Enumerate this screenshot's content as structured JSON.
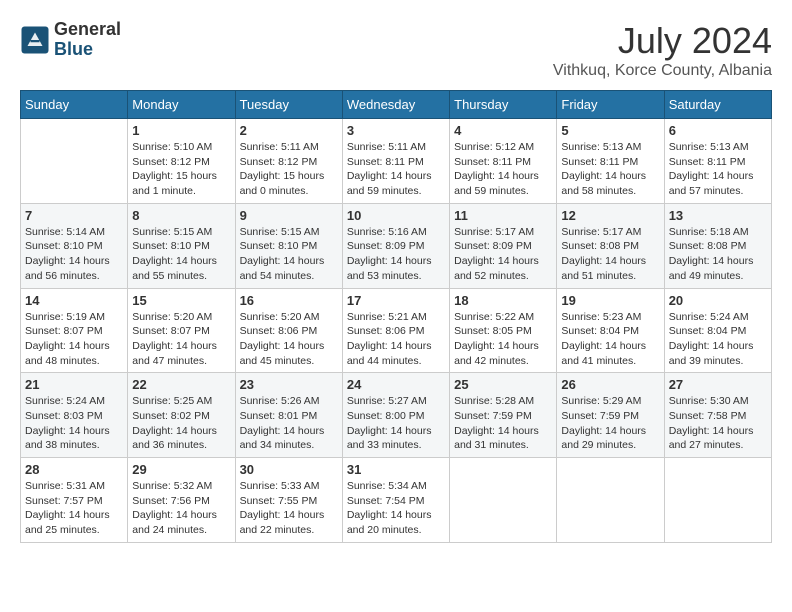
{
  "logo": {
    "general": "General",
    "blue": "Blue"
  },
  "title": {
    "month_year": "July 2024",
    "location": "Vithkuq, Korce County, Albania"
  },
  "calendar": {
    "headers": [
      "Sunday",
      "Monday",
      "Tuesday",
      "Wednesday",
      "Thursday",
      "Friday",
      "Saturday"
    ],
    "weeks": [
      [
        {
          "day": "",
          "info": ""
        },
        {
          "day": "1",
          "info": "Sunrise: 5:10 AM\nSunset: 8:12 PM\nDaylight: 15 hours\nand 1 minute."
        },
        {
          "day": "2",
          "info": "Sunrise: 5:11 AM\nSunset: 8:12 PM\nDaylight: 15 hours\nand 0 minutes."
        },
        {
          "day": "3",
          "info": "Sunrise: 5:11 AM\nSunset: 8:11 PM\nDaylight: 14 hours\nand 59 minutes."
        },
        {
          "day": "4",
          "info": "Sunrise: 5:12 AM\nSunset: 8:11 PM\nDaylight: 14 hours\nand 59 minutes."
        },
        {
          "day": "5",
          "info": "Sunrise: 5:13 AM\nSunset: 8:11 PM\nDaylight: 14 hours\nand 58 minutes."
        },
        {
          "day": "6",
          "info": "Sunrise: 5:13 AM\nSunset: 8:11 PM\nDaylight: 14 hours\nand 57 minutes."
        }
      ],
      [
        {
          "day": "7",
          "info": "Sunrise: 5:14 AM\nSunset: 8:10 PM\nDaylight: 14 hours\nand 56 minutes."
        },
        {
          "day": "8",
          "info": "Sunrise: 5:15 AM\nSunset: 8:10 PM\nDaylight: 14 hours\nand 55 minutes."
        },
        {
          "day": "9",
          "info": "Sunrise: 5:15 AM\nSunset: 8:10 PM\nDaylight: 14 hours\nand 54 minutes."
        },
        {
          "day": "10",
          "info": "Sunrise: 5:16 AM\nSunset: 8:09 PM\nDaylight: 14 hours\nand 53 minutes."
        },
        {
          "day": "11",
          "info": "Sunrise: 5:17 AM\nSunset: 8:09 PM\nDaylight: 14 hours\nand 52 minutes."
        },
        {
          "day": "12",
          "info": "Sunrise: 5:17 AM\nSunset: 8:08 PM\nDaylight: 14 hours\nand 51 minutes."
        },
        {
          "day": "13",
          "info": "Sunrise: 5:18 AM\nSunset: 8:08 PM\nDaylight: 14 hours\nand 49 minutes."
        }
      ],
      [
        {
          "day": "14",
          "info": "Sunrise: 5:19 AM\nSunset: 8:07 PM\nDaylight: 14 hours\nand 48 minutes."
        },
        {
          "day": "15",
          "info": "Sunrise: 5:20 AM\nSunset: 8:07 PM\nDaylight: 14 hours\nand 47 minutes."
        },
        {
          "day": "16",
          "info": "Sunrise: 5:20 AM\nSunset: 8:06 PM\nDaylight: 14 hours\nand 45 minutes."
        },
        {
          "day": "17",
          "info": "Sunrise: 5:21 AM\nSunset: 8:06 PM\nDaylight: 14 hours\nand 44 minutes."
        },
        {
          "day": "18",
          "info": "Sunrise: 5:22 AM\nSunset: 8:05 PM\nDaylight: 14 hours\nand 42 minutes."
        },
        {
          "day": "19",
          "info": "Sunrise: 5:23 AM\nSunset: 8:04 PM\nDaylight: 14 hours\nand 41 minutes."
        },
        {
          "day": "20",
          "info": "Sunrise: 5:24 AM\nSunset: 8:04 PM\nDaylight: 14 hours\nand 39 minutes."
        }
      ],
      [
        {
          "day": "21",
          "info": "Sunrise: 5:24 AM\nSunset: 8:03 PM\nDaylight: 14 hours\nand 38 minutes."
        },
        {
          "day": "22",
          "info": "Sunrise: 5:25 AM\nSunset: 8:02 PM\nDaylight: 14 hours\nand 36 minutes."
        },
        {
          "day": "23",
          "info": "Sunrise: 5:26 AM\nSunset: 8:01 PM\nDaylight: 14 hours\nand 34 minutes."
        },
        {
          "day": "24",
          "info": "Sunrise: 5:27 AM\nSunset: 8:00 PM\nDaylight: 14 hours\nand 33 minutes."
        },
        {
          "day": "25",
          "info": "Sunrise: 5:28 AM\nSunset: 7:59 PM\nDaylight: 14 hours\nand 31 minutes."
        },
        {
          "day": "26",
          "info": "Sunrise: 5:29 AM\nSunset: 7:59 PM\nDaylight: 14 hours\nand 29 minutes."
        },
        {
          "day": "27",
          "info": "Sunrise: 5:30 AM\nSunset: 7:58 PM\nDaylight: 14 hours\nand 27 minutes."
        }
      ],
      [
        {
          "day": "28",
          "info": "Sunrise: 5:31 AM\nSunset: 7:57 PM\nDaylight: 14 hours\nand 25 minutes."
        },
        {
          "day": "29",
          "info": "Sunrise: 5:32 AM\nSunset: 7:56 PM\nDaylight: 14 hours\nand 24 minutes."
        },
        {
          "day": "30",
          "info": "Sunrise: 5:33 AM\nSunset: 7:55 PM\nDaylight: 14 hours\nand 22 minutes."
        },
        {
          "day": "31",
          "info": "Sunrise: 5:34 AM\nSunset: 7:54 PM\nDaylight: 14 hours\nand 20 minutes."
        },
        {
          "day": "",
          "info": ""
        },
        {
          "day": "",
          "info": ""
        },
        {
          "day": "",
          "info": ""
        }
      ]
    ]
  }
}
